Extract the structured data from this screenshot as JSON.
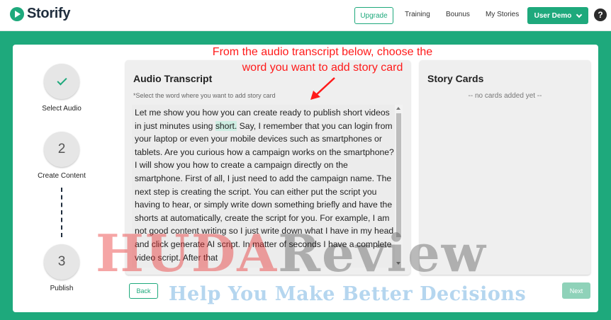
{
  "app": {
    "logo_text": "Storify"
  },
  "nav": {
    "upgrade": "Upgrade",
    "training": "Training",
    "bonus": "Bounus",
    "stories": "My Stories",
    "user": "User Demo",
    "help": "?"
  },
  "steps": [
    {
      "number": "✓",
      "label": "Select Audio",
      "state": "done"
    },
    {
      "number": "2",
      "label": "Create Content",
      "state": "active"
    },
    {
      "number": "3",
      "label": "Publish",
      "state": "pending"
    }
  ],
  "transcript": {
    "title": "Audio Transcript",
    "hint": "*Select the word where you want to add story card",
    "text_before": "Let me show you how you can create ready to publish short videos in just minutes using ",
    "highlighted_word": "short.",
    "text_after": " Say, I remember that you can login from your laptop or even your mobile devices such as smartphones or tablets. Are you curious how a campaign works on the smartphone? I will show you how to create a campaign directly on the smartphone. First of all, I just need to add the campaign name. The next step is creating the script. You can either put the script you having to hear, or simply write down something briefly and have the shorts at automatically, create the script for you. For example, I am not good content writing so I just write down what I have in my head and click generate AI script. In matter of seconds I have a complete video script. After that"
  },
  "story_cards": {
    "title": "Story Cards",
    "empty_text": "-- no cards added yet --"
  },
  "buttons": {
    "back": "Back",
    "next": "Next"
  },
  "annotation": {
    "text": "From the audio transcript below, choose the word you want to add story card"
  },
  "watermark": {
    "main_part1": "HUDA",
    "main_part2": "Review",
    "sub": "Help You Make Better Decisions"
  },
  "colors": {
    "brand": "#1ea97c",
    "highlight": "#cdeee2",
    "annotation": "#ff1a1a"
  }
}
